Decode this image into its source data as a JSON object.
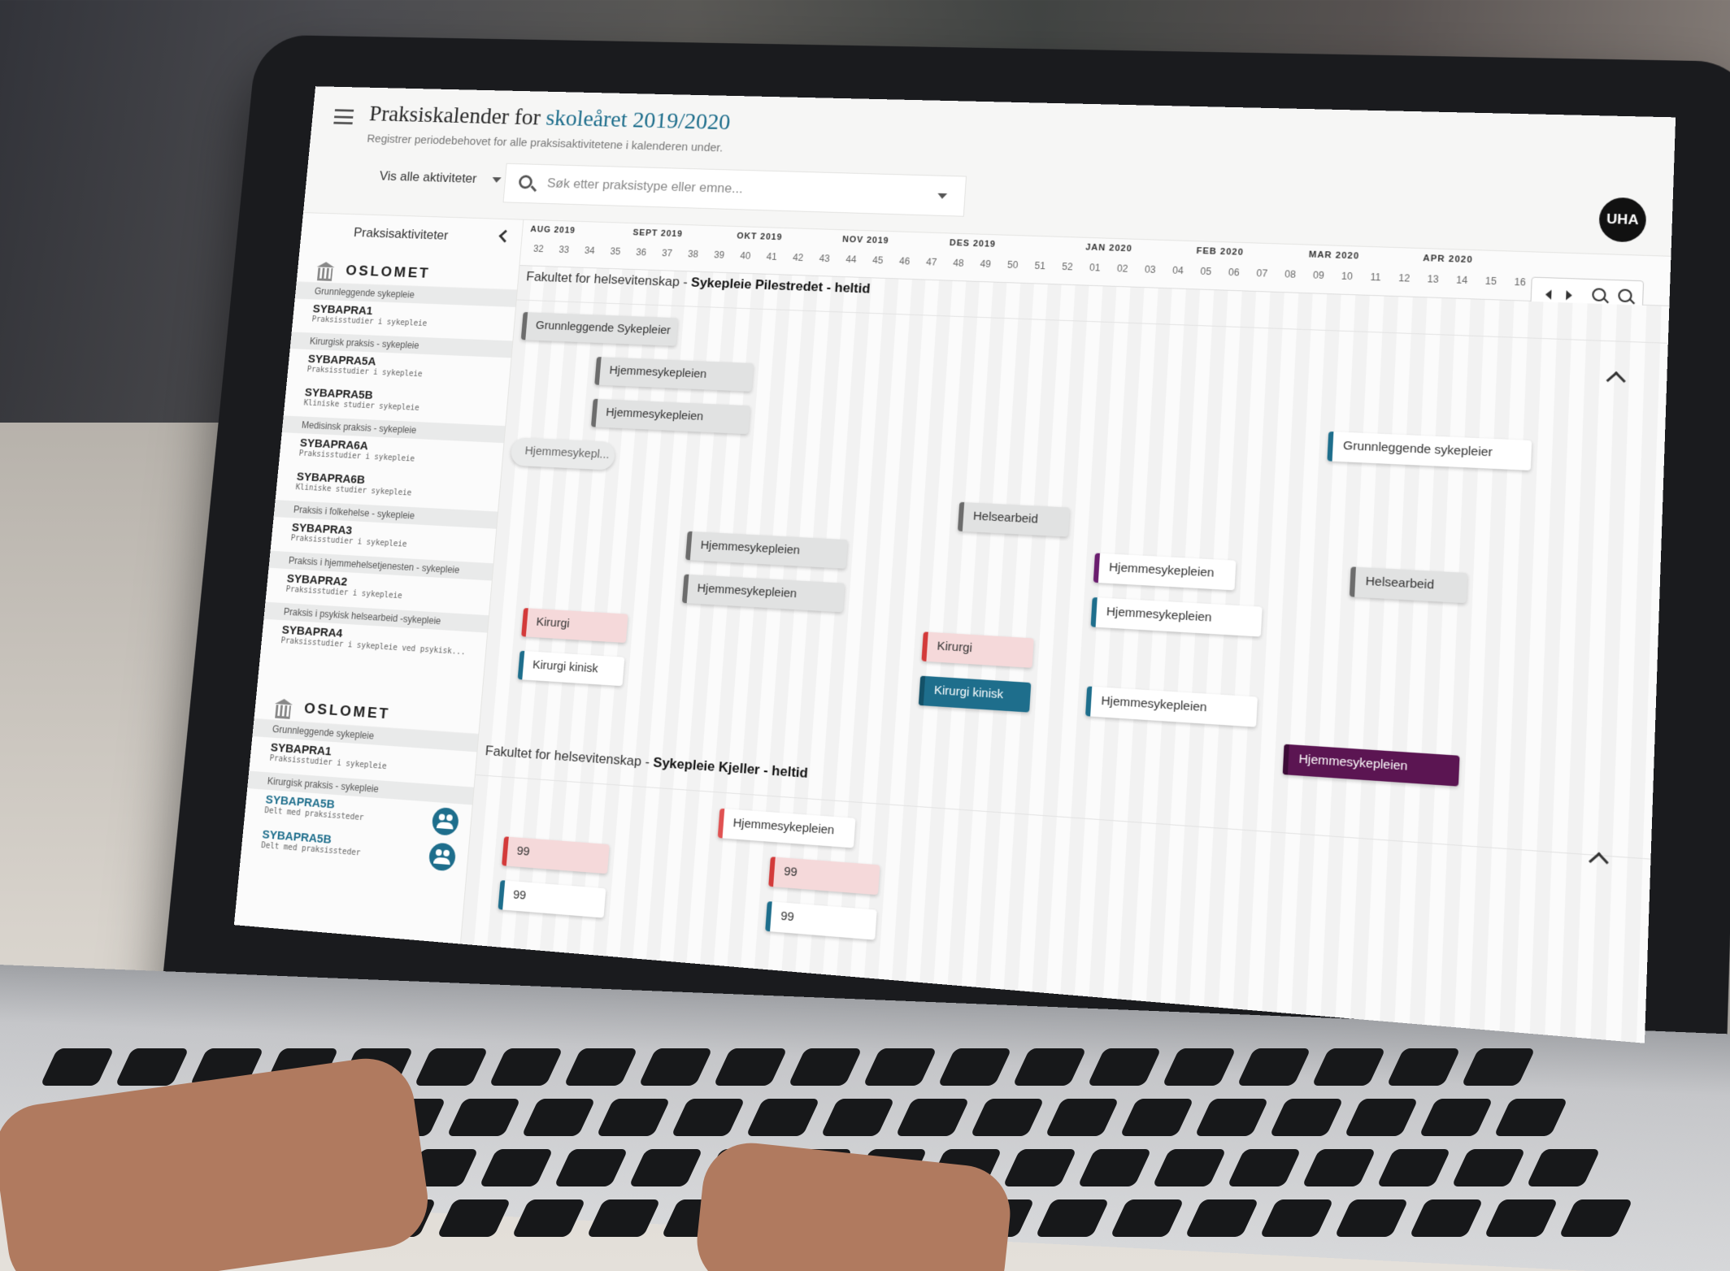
{
  "header": {
    "title_prefix": "Praksiskalender for",
    "title_accent": "skoleåret 2019/2020",
    "subtitle": "Registrer periodebehovet for alle praksisaktivitetene i kalenderen under.",
    "filter_label": "Vis alle aktiviteter",
    "search_placeholder": "Søk etter praksistype eller emne...",
    "avatar_label": "UHA"
  },
  "sidebar": {
    "heading": "Praksisaktiviteter",
    "orgs": [
      {
        "name": "OSLOMET",
        "groups": [
          {
            "label": "Grunnleggende sykepleie",
            "courses": [
              {
                "code": "SYBAPRA1",
                "desc": "Praksisstudier i sykepleie"
              }
            ]
          },
          {
            "label": "Kirurgisk praksis - sykepleie",
            "courses": [
              {
                "code": "SYBAPRA5A",
                "desc": "Praksisstudier i sykepleie"
              },
              {
                "code": "SYBAPRA5B",
                "desc": "Kliniske studier sykepleie"
              }
            ]
          },
          {
            "label": "Medisinsk praksis - sykepleie",
            "courses": [
              {
                "code": "SYBAPRA6A",
                "desc": "Praksisstudier i sykepleie"
              },
              {
                "code": "SYBAPRA6B",
                "desc": "Kliniske studier sykepleie"
              }
            ]
          },
          {
            "label": "Praksis i folkehelse - sykepleie",
            "courses": [
              {
                "code": "SYBAPRA3",
                "desc": "Praksisstudier i sykepleie"
              }
            ]
          },
          {
            "label": "Praksis i hjemmehelsetjenesten - sykepleie",
            "courses": [
              {
                "code": "SYBAPRA2",
                "desc": "Praksisstudier i sykepleie"
              }
            ]
          },
          {
            "label": "Praksis i psykisk helsearbeid -sykepleie",
            "courses": [
              {
                "code": "SYBAPRA4",
                "desc": "Praksisstudier i sykepleie ved psykisk..."
              }
            ]
          }
        ]
      },
      {
        "name": "OSLOMET",
        "groups": [
          {
            "label": "Grunnleggende sykepleie",
            "courses": [
              {
                "code": "SYBAPRA1",
                "desc": "Praksisstudier i sykepleie"
              }
            ]
          },
          {
            "label": "Kirurgisk praksis - sykepleie",
            "courses": [
              {
                "code": "SYBAPRA5B",
                "desc": "Delt med praksissteder"
              },
              {
                "code": "SYBAPRA5B",
                "desc": "Delt med praksissteder"
              }
            ]
          }
        ]
      }
    ]
  },
  "calendar": {
    "months": [
      {
        "label": "AUG 2019",
        "week_index": 0
      },
      {
        "label": "SEPT 2019",
        "week_index": 4
      },
      {
        "label": "OKT 2019",
        "week_index": 8
      },
      {
        "label": "NOV 2019",
        "week_index": 12
      },
      {
        "label": "DES 2019",
        "week_index": 16
      },
      {
        "label": "JAN 2020",
        "week_index": 21
      },
      {
        "label": "FEB 2020",
        "week_index": 25
      },
      {
        "label": "MAR 2020",
        "week_index": 29
      },
      {
        "label": "APR 2020",
        "week_index": 33
      }
    ],
    "weeks": [
      "32",
      "33",
      "34",
      "35",
      "36",
      "37",
      "38",
      "39",
      "40",
      "41",
      "42",
      "43",
      "44",
      "45",
      "46",
      "47",
      "48",
      "49",
      "50",
      "51",
      "52",
      "01",
      "02",
      "03",
      "04",
      "05",
      "06",
      "07",
      "08",
      "09",
      "10",
      "11",
      "12",
      "13",
      "14",
      "15",
      "16"
    ],
    "sections": [
      {
        "faculty": "Fakultet for helsevitenskap - ",
        "program": "Sykepleie Pilestredet - heltid"
      },
      {
        "faculty": "Fakultet for helsevitenskap - ",
        "program": "Sykepleie Kjeller - heltid"
      }
    ],
    "bars": [
      {
        "label": "Grunnleggende Sykepleier",
        "style": "grey",
        "start": 0,
        "len": 6,
        "row": 0
      },
      {
        "label": "Grunnleggende sykepleier",
        "style": "white-teal",
        "start": 30,
        "len": 7,
        "row": 2
      },
      {
        "label": "Hjemmesykepleien",
        "style": "grey",
        "start": 3,
        "len": 6,
        "row": 1
      },
      {
        "label": "Hjemmesykepleien",
        "style": "grey",
        "start": 3,
        "len": 6,
        "row": 2
      },
      {
        "label": "Hjemmesykepl...",
        "style": "plain",
        "start": 0,
        "len": 4,
        "row": 3
      },
      {
        "label": "Helsearbeid",
        "style": "grey",
        "start": 17,
        "len": 4,
        "row": 4
      },
      {
        "label": "Hjemmesykepleien",
        "style": "grey",
        "start": 7,
        "len": 6,
        "row": 5
      },
      {
        "label": "Hjemmesykepleien",
        "style": "white-purple",
        "start": 22,
        "len": 5,
        "row": 5
      },
      {
        "label": "Helsearbeid",
        "style": "grey",
        "start": 31,
        "len": 4,
        "row": 5
      },
      {
        "label": "Hjemmesykepleien",
        "style": "grey",
        "start": 7,
        "len": 6,
        "row": 6
      },
      {
        "label": "Hjemmesykepleien",
        "style": "white-teal",
        "start": 22,
        "len": 6,
        "row": 6
      },
      {
        "label": "Kirurgi",
        "style": "pink",
        "start": 1,
        "len": 4,
        "row": 7
      },
      {
        "label": "Kirurgi",
        "style": "pink",
        "start": 16,
        "len": 4,
        "row": 7
      },
      {
        "label": "Hjemmesykepleien",
        "style": "white-teal",
        "start": 22,
        "len": 6,
        "row": 8
      },
      {
        "label": "Kirurgi kinisk",
        "style": "white-teal",
        "start": 1,
        "len": 4,
        "row": 8
      },
      {
        "label": "Kirurgi kinisk",
        "style": "teal-solid",
        "start": 16,
        "len": 4,
        "row": 8
      },
      {
        "label": "Hjemmesykepleien",
        "style": "purple-solid",
        "start": 29,
        "len": 6,
        "row": 9
      },
      {
        "label": "Hjemmesykepleien",
        "style": "white-red",
        "start": 9,
        "len": 5,
        "row": 10
      },
      {
        "label": "99",
        "style": "pink",
        "start": 1,
        "len": 4,
        "row": 11
      },
      {
        "label": "99",
        "style": "pink",
        "start": 11,
        "len": 4,
        "row": 11
      },
      {
        "label": "99",
        "style": "white-teal",
        "start": 1,
        "len": 4,
        "row": 12
      },
      {
        "label": "99",
        "style": "white-teal",
        "start": 11,
        "len": 4,
        "row": 12
      }
    ]
  }
}
